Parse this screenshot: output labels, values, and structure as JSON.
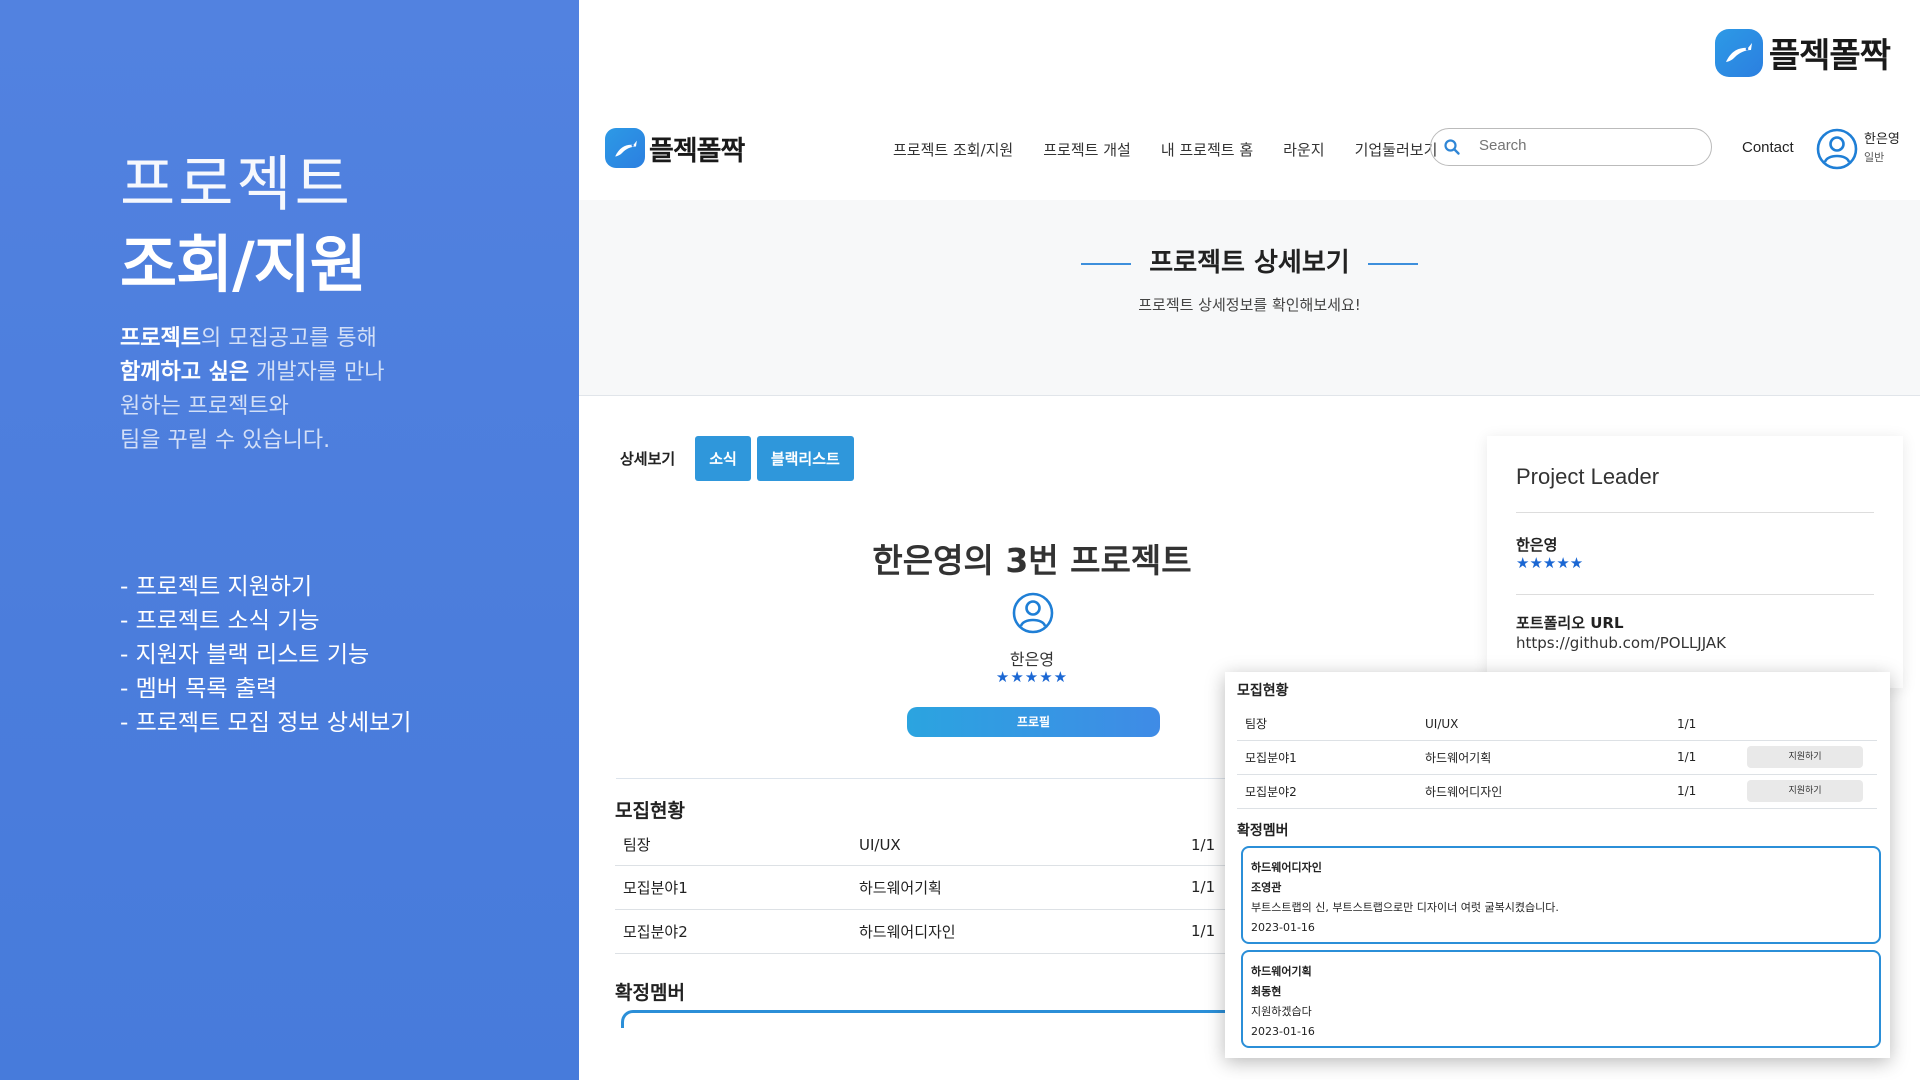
{
  "intro": {
    "title_light": "프로젝트",
    "title_bold": "조회/지원",
    "desc_line1_bold": "프로젝트",
    "desc_line1_rest": "의 모집공고를 통해",
    "desc_line2_bold": "함께하고 싶은",
    "desc_line2_rest": " 개발자를 만나",
    "desc_line3": "원하는 프로젝트와",
    "desc_line4": "팀을 꾸릴 수 있습니다.",
    "features": [
      "- 프로젝트 지원하기",
      "- 프로젝트 소식 기능",
      "- 지원자 블랙 리스트 기능",
      "- 멤버 목록 출력",
      "- 프로젝트 모집 정보 상세보기"
    ]
  },
  "brand": {
    "name": "플젝폴짝"
  },
  "navbar": {
    "menu": [
      "프로젝트 조회/지원",
      "프로젝트 개설",
      "내 프로젝트 홈",
      "라운지",
      "기업둘러보기"
    ],
    "search_placeholder": "Search",
    "contact": "Contact",
    "user_name": "한은영",
    "user_role": "일반"
  },
  "header": {
    "title": "프로젝트 상세보기",
    "subtitle": "프로젝트 상세정보를 확인해보세요!"
  },
  "tabs": {
    "detail": "상세보기",
    "news": "소식",
    "blacklist": "블랙리스트"
  },
  "project": {
    "title": "한은영의 3번 프로젝트",
    "owner": "한은영",
    "rating_stars": "★★★★★",
    "profile_button": "프로필"
  },
  "recruitment": {
    "title": "모집현황",
    "rows": [
      {
        "role": "팀장",
        "field": "UI/UX",
        "count": "1/1"
      },
      {
        "role": "모집분야1",
        "field": "하드웨어기획",
        "count": "1/1"
      },
      {
        "role": "모집분야2",
        "field": "하드웨어디자인",
        "count": "1/1"
      }
    ],
    "apply_label": "지원하기"
  },
  "confirmed": {
    "title": "확정멤버",
    "members": [
      {
        "field": "하드웨어디자인",
        "name": "조영관",
        "comment": "부트스트랩의 신, 부트스트랩으로만 디자이너 여럿 굴복시켰습니다.",
        "date": "2023-01-16"
      },
      {
        "field": "하드웨어기획",
        "name": "최동현",
        "comment": "지원하겠습다",
        "date": "2023-01-16"
      }
    ]
  },
  "leader": {
    "title": "Project Leader",
    "name": "한은영",
    "rating_stars": "★★★★★",
    "portfolio_label": "포트폴리오 URL",
    "portfolio_url": "https://github.com/POLLJJAK"
  },
  "colors": {
    "panel_blue": "#4b7ddc",
    "accent": "#2f97db",
    "star": "#1b67d3"
  },
  "icons": [
    "rabbit-logo-icon",
    "search-icon",
    "user-avatar-icon"
  ]
}
